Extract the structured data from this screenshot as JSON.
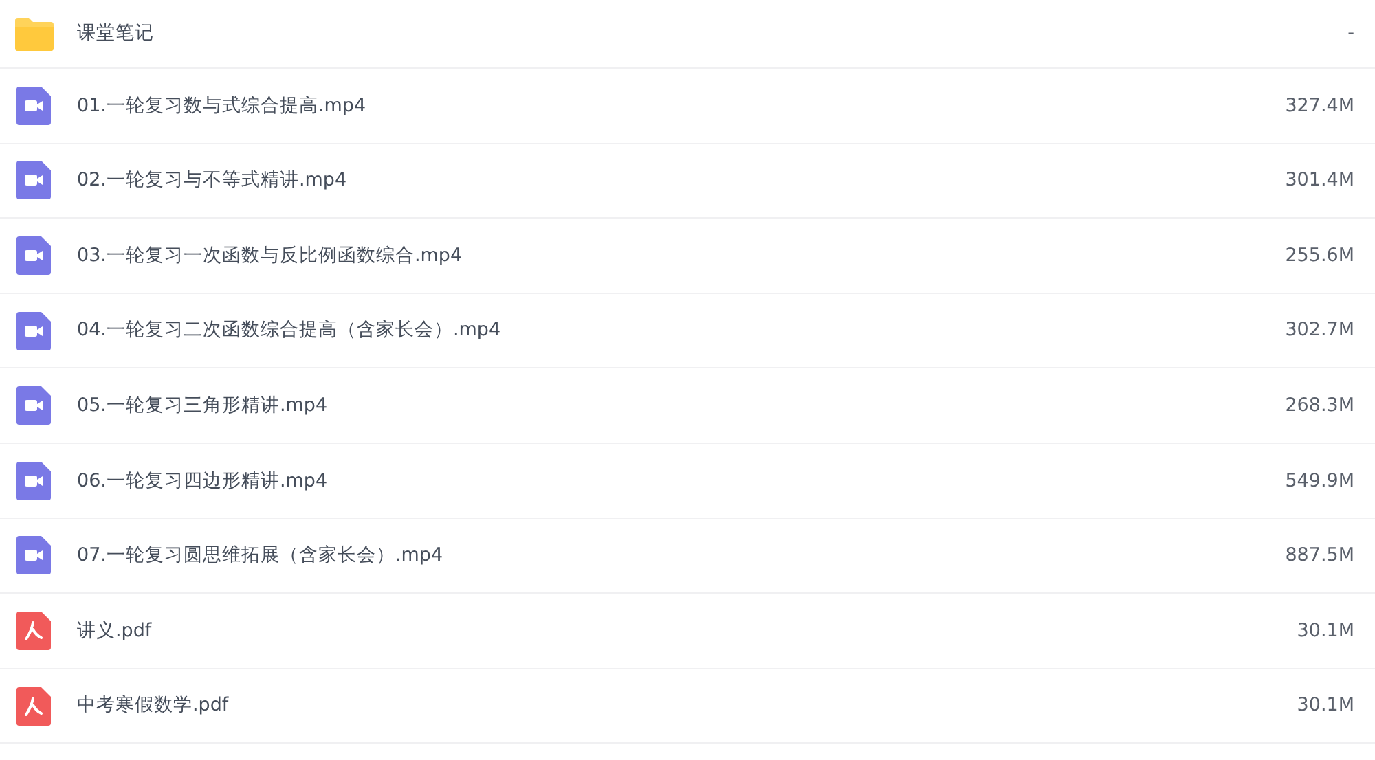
{
  "files": [
    {
      "kind": "folder",
      "name": "课堂笔记",
      "size": "-"
    },
    {
      "kind": "video",
      "name": "01.一轮复习数与式综合提高.mp4",
      "size": "327.4M"
    },
    {
      "kind": "video",
      "name": "02.一轮复习与不等式精讲.mp4",
      "size": "301.4M"
    },
    {
      "kind": "video",
      "name": "03.一轮复习一次函数与反比例函数综合.mp4",
      "size": "255.6M"
    },
    {
      "kind": "video",
      "name": "04.一轮复习二次函数综合提高（含家长会）.mp4",
      "size": "302.7M"
    },
    {
      "kind": "video",
      "name": "05.一轮复习三角形精讲.mp4",
      "size": "268.3M"
    },
    {
      "kind": "video",
      "name": "06.一轮复习四边形精讲.mp4",
      "size": "549.9M"
    },
    {
      "kind": "video",
      "name": "07.一轮复习圆思维拓展（含家长会）.mp4",
      "size": "887.5M"
    },
    {
      "kind": "pdf",
      "name": "讲义.pdf",
      "size": "30.1M"
    },
    {
      "kind": "pdf",
      "name": "中考寒假数学.pdf",
      "size": "30.1M"
    }
  ]
}
